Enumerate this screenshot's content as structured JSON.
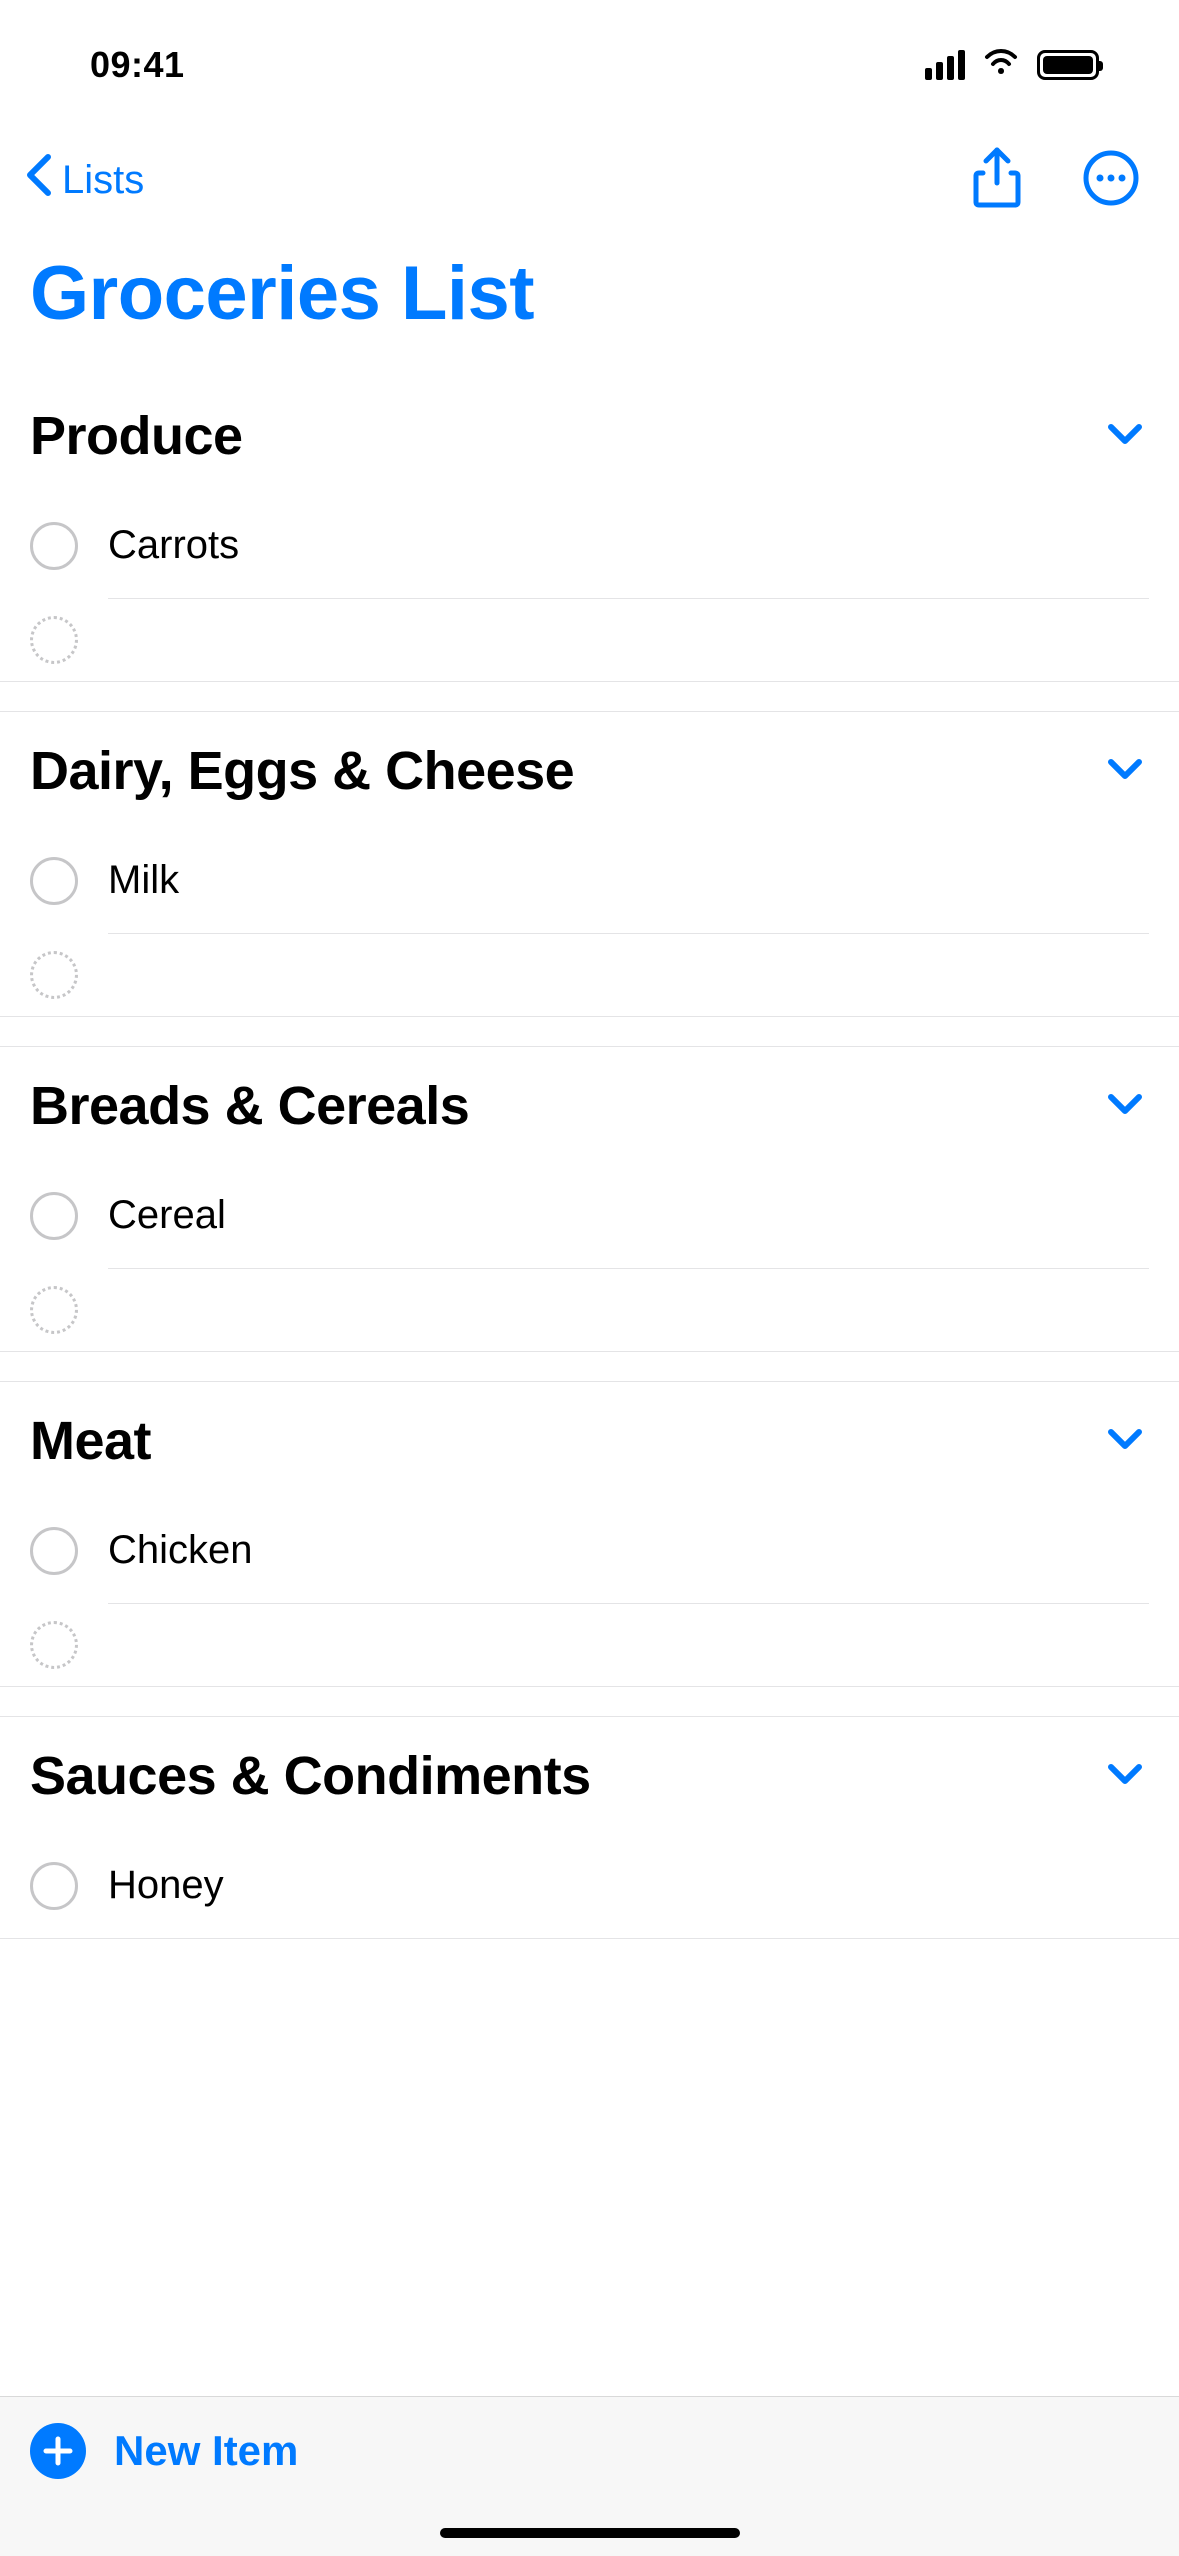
{
  "status": {
    "time": "09:41"
  },
  "nav": {
    "back_label": "Lists"
  },
  "title": "Groceries List",
  "sections": [
    {
      "title": "Produce",
      "items": [
        {
          "label": "Carrots"
        }
      ]
    },
    {
      "title": "Dairy, Eggs & Cheese",
      "items": [
        {
          "label": "Milk"
        }
      ]
    },
    {
      "title": "Breads & Cereals",
      "items": [
        {
          "label": "Cereal"
        }
      ]
    },
    {
      "title": "Meat",
      "items": [
        {
          "label": "Chicken"
        }
      ]
    },
    {
      "title": "Sauces & Condiments",
      "items": [
        {
          "label": "Honey"
        }
      ]
    }
  ],
  "bottom": {
    "new_item_label": "New Item"
  },
  "colors": {
    "accent": "#007aff"
  }
}
